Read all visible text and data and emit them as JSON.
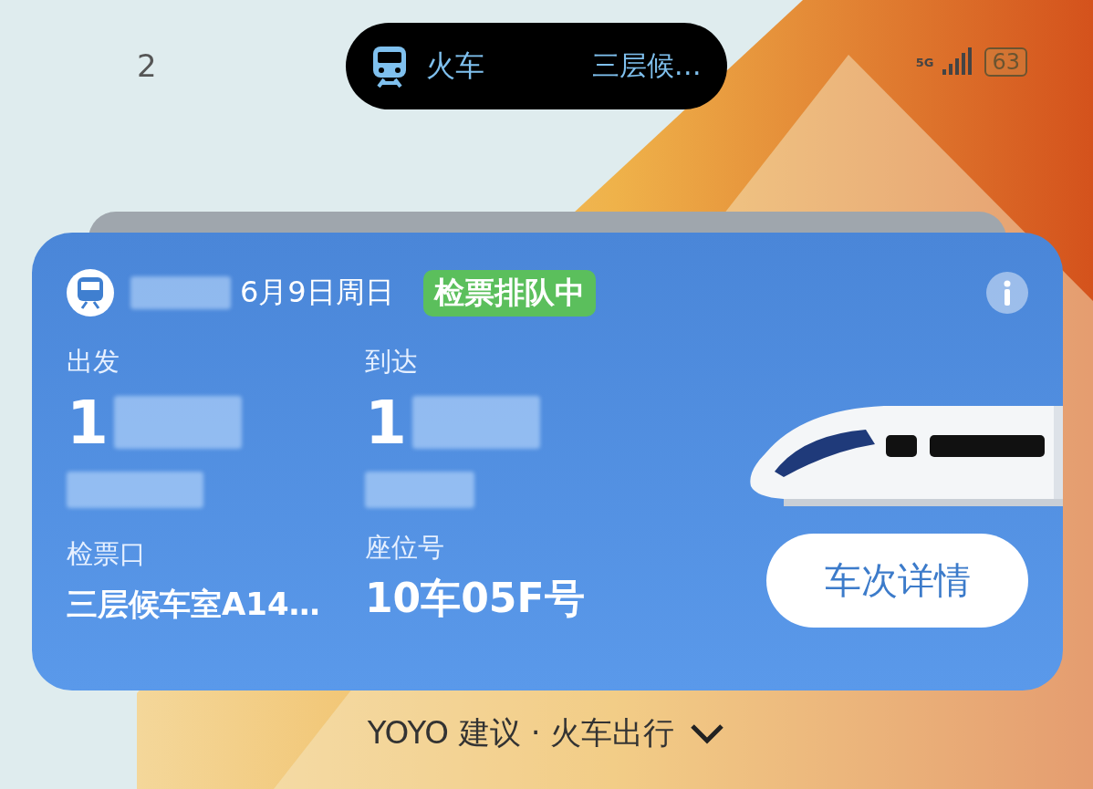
{
  "status_bar": {
    "time": "2",
    "network": "5G",
    "battery": "63"
  },
  "island": {
    "label": "火车",
    "detail": "三层候…"
  },
  "card": {
    "date": "6月9日周日",
    "status": "检票排队中",
    "departure": {
      "label": "出发",
      "time": "1"
    },
    "arrival": {
      "label": "到达",
      "time": "1"
    },
    "gate": {
      "label": "检票口",
      "value": "三层候车室A14…"
    },
    "seat": {
      "label": "座位号",
      "value": "10车05F号"
    },
    "button": "车次详情"
  },
  "suggestion": "YOYO 建议 · 火车出行"
}
